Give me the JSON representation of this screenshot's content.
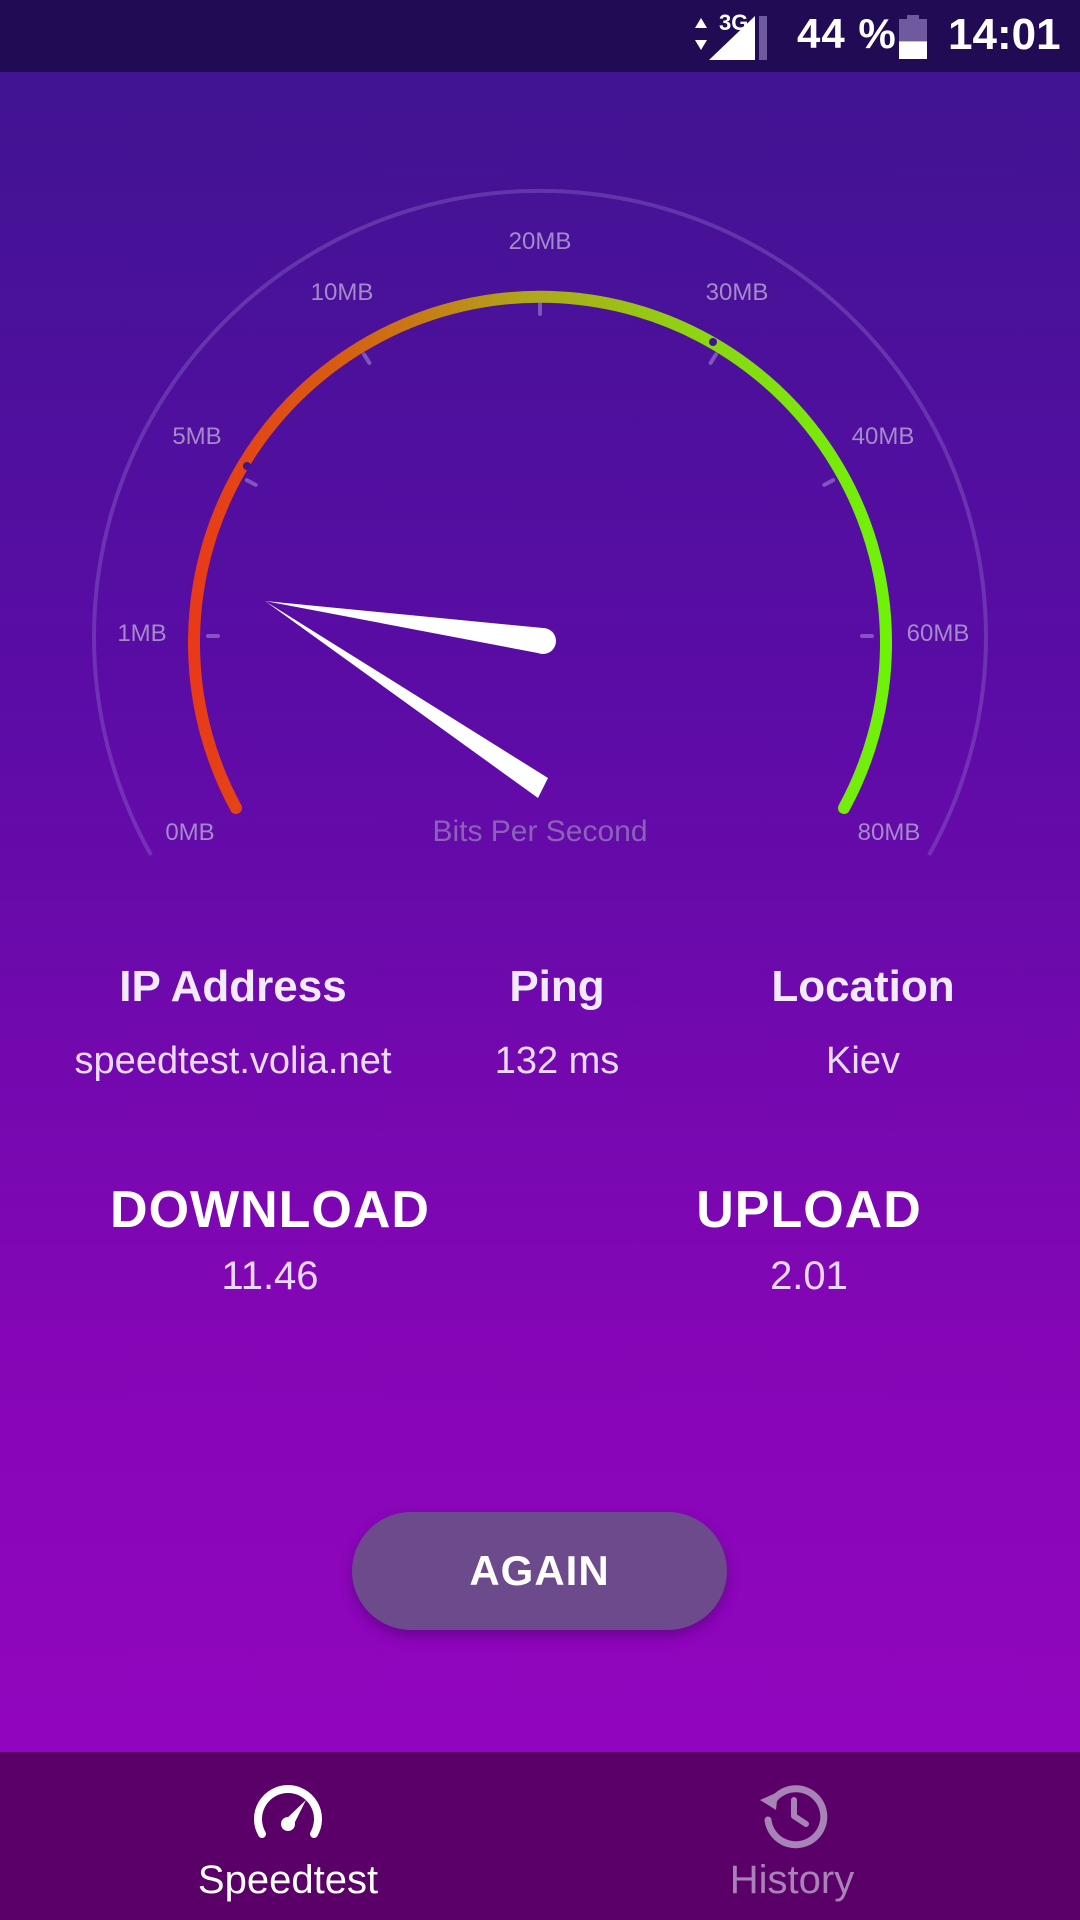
{
  "status_bar": {
    "network": "3G",
    "battery_percent": "44 %",
    "battery_level": 0.44,
    "time": "14:01",
    "icons": [
      "data-arrows-icon",
      "signal-icon",
      "battery-icon"
    ]
  },
  "gauge": {
    "tick_labels": [
      "0MB",
      "1MB",
      "5MB",
      "10MB",
      "20MB",
      "30MB",
      "40MB",
      "60MB",
      "80MB"
    ],
    "unit_label": "Bits Per Second",
    "colors": {
      "low": "#e83a18",
      "mid": "#b0a51a",
      "high": "#6ff20a"
    }
  },
  "info": {
    "ip": {
      "title": "IP Address",
      "value": "speedtest.volia.net"
    },
    "ping": {
      "title": "Ping",
      "value": "132 ms"
    },
    "location": {
      "title": "Location",
      "value": "Kiev"
    }
  },
  "results": {
    "download": {
      "title": "DOWNLOAD",
      "value": "11.46"
    },
    "upload": {
      "title": "UPLOAD",
      "value": "2.01"
    }
  },
  "again_label": "AGAIN",
  "nav": {
    "speedtest": {
      "label": "Speedtest",
      "icon": "speedometer-icon",
      "active": true
    },
    "history": {
      "label": "History",
      "icon": "history-icon",
      "active": false
    }
  }
}
